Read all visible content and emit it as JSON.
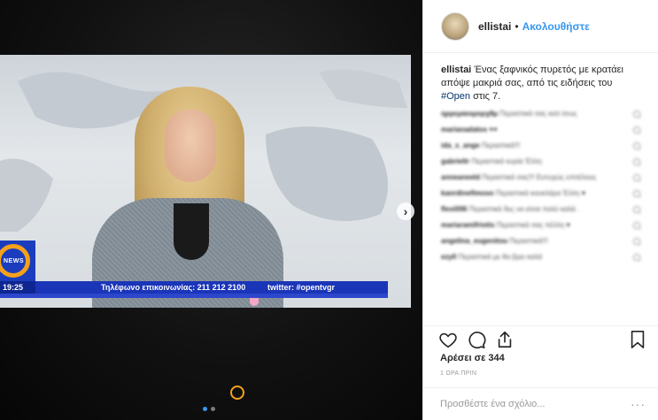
{
  "photo": {
    "ticker": {
      "time": "19:25",
      "phone_text": "Τηλέφωνο επικοινωνίας: 211 212 2100",
      "twitter_text": "twitter: #opentvgr"
    },
    "channel_logo_text": "NEWS",
    "next_glyph": "›",
    "carousel_dots": 2,
    "active_dot": 0
  },
  "header": {
    "username": "ellistai",
    "separator": "•",
    "follow_label": "Ακολουθήστε"
  },
  "caption": {
    "username": "ellistai",
    "text_before_tag": "Ένας ξαφνικός πυρετός με κρατάει απόψε μακριά σας, από τις ειδήσεις του",
    "hashtag": "#Open",
    "text_after_tag": " στις 7."
  },
  "comments": [
    {
      "user": "ηρρεμαιομορχθμ",
      "text": "Περαστικά σας κατι ίσως"
    },
    {
      "user": "marianadatos",
      "text": "♥♥"
    },
    {
      "user": "ida_x_ange",
      "text": "Περαστικά!!!"
    },
    {
      "user": "gabrieltr",
      "text": "Περαστικά κυρία Έλλη"
    },
    {
      "user": "anneaneeld",
      "text": "Περαστικά σας!!! Ευτυχώς επιτέλους"
    },
    {
      "user": "kanrdinefimoso",
      "text": "Περαστικά κουκλάρα Έλλη ♥"
    },
    {
      "user": "flexi006",
      "text": "Περαστικά δες να είσαι πολύ καλά ."
    },
    {
      "user": "mariaramifriotis",
      "text": "Περαστικά σας πέλλη ♥"
    },
    {
      "user": "angelina_eugenitou",
      "text": "Περαστικά!!!"
    },
    {
      "user": "ezy0",
      "text": "Περαστικά με θα βρει καλά"
    }
  ],
  "actions": {
    "like_icon": "heart-icon",
    "comment_icon": "comment-icon",
    "share_icon": "share-icon",
    "save_icon": "bookmark-icon"
  },
  "likes_text": "Αρέσει σε 344",
  "time_ago": "1 ΩΡΑ ΠΡΙΝ",
  "add_comment": {
    "placeholder": "Προσθέστε ένα σχόλιο...",
    "more_glyph": "···"
  },
  "colors": {
    "accent": "#3897f0",
    "ticker_blue": "#1a35b8",
    "brand_orange": "#f5a11a"
  }
}
